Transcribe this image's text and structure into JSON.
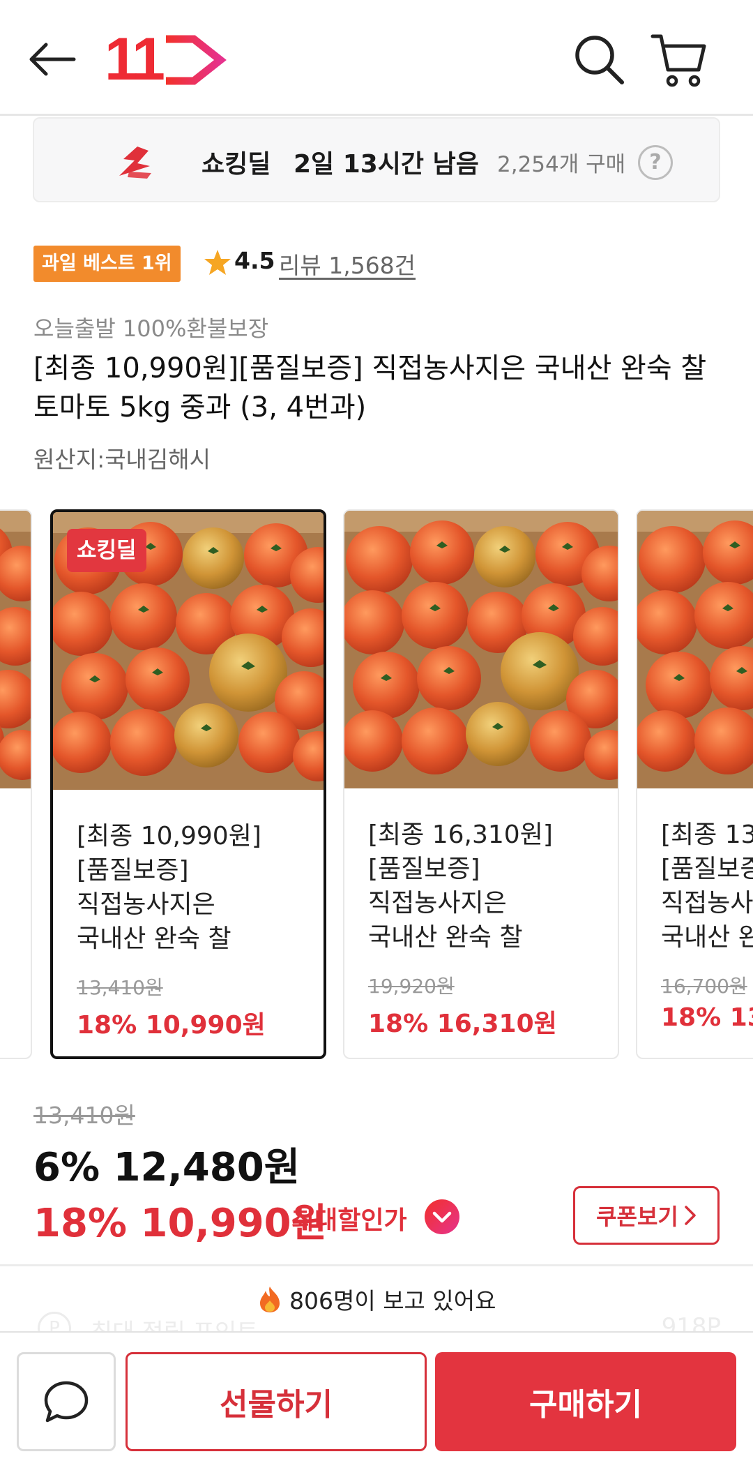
{
  "header": {
    "logo_text": "11",
    "back_icon": "arrow-left-icon",
    "search_icon": "search-icon",
    "cart_icon": "cart-icon"
  },
  "deal_banner": {
    "title": "쇼킹딜",
    "time_left": "2일 13시간 남음",
    "purchase_count": "2,254개 구매",
    "help": "?"
  },
  "product": {
    "badge": "과일 베스트 1위",
    "rating": "4.5",
    "review_label": "리뷰 1,568건",
    "tags": "오늘출발 100%환불보장",
    "title": "[최종 10,990원][품질보증] 직접농사지은 국내산 완숙 찰 토마토 5kg 중과 (3, 4번과)",
    "origin": "원산지:국내김해시"
  },
  "options": [
    {
      "tag": "쇼킹딜",
      "desc": "[최종 10,990원]\n[품질보증]\n직접농사지은\n국내산 완숙 찰",
      "original_price": "13,410원",
      "price": "18% 10,990원",
      "selected": true
    },
    {
      "tag": "",
      "desc": "[최종 16,310원]\n[품질보증]\n직접농사지은\n국내산 완숙 찰",
      "original_price": "19,920원",
      "price": "18% 16,310원",
      "selected": false
    },
    {
      "tag": "",
      "desc": "[최종 13\n[품질보증\n직접농사\n국내산 완",
      "original_price": "16,700원",
      "price": "18% 13,",
      "selected": false
    }
  ],
  "pricing": {
    "original_price": "13,410원",
    "price_6": "6% 12,480원",
    "price_18": "18% 10,990원",
    "max_discount_label": "최대할인가",
    "coupon_button": "쿠폰보기"
  },
  "viewers": "806명이 보고 있어요",
  "points": {
    "label": "최대 적립 포인트",
    "value": "918P",
    "icon": "P"
  },
  "bottom_bar": {
    "gift_button": "선물하기",
    "buy_button": "구매하기",
    "chat_icon": "chat-bubble-icon"
  },
  "colors": {
    "accent_red": "#e0303a",
    "badge_orange": "#f28b2c",
    "star": "#f6a623",
    "logo_red": "#ee2b34",
    "logo_pink": "#e6328c"
  }
}
